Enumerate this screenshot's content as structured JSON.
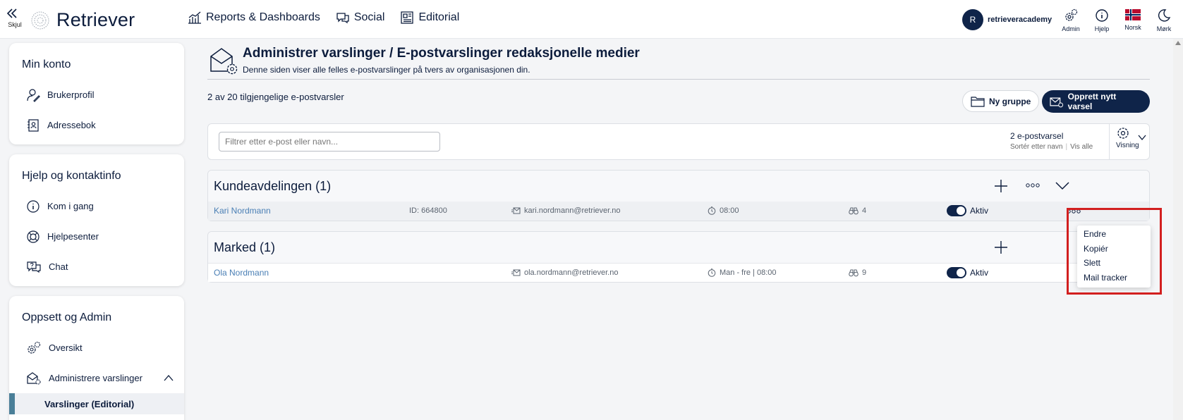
{
  "topbar": {
    "hide_label": "Skjul",
    "logo_text": "Retriever",
    "nav": [
      {
        "label": "Reports & Dashboards",
        "icon": "chart-icon"
      },
      {
        "label": "Social",
        "icon": "chat-bubbles-icon"
      },
      {
        "label": "Editorial",
        "icon": "newspaper-icon"
      }
    ],
    "user": {
      "initial": "R",
      "name": "retrieveracademy"
    },
    "icons": [
      {
        "label": "Admin",
        "icon": "admin-gear-icon"
      },
      {
        "label": "Hjelp",
        "icon": "info-icon"
      },
      {
        "label": "Norsk",
        "icon": "norway-flag-icon"
      },
      {
        "label": "Mørk",
        "icon": "moon-icon"
      }
    ]
  },
  "sidebar": {
    "account": {
      "title": "Min konto",
      "items": [
        {
          "label": "Brukerprofil",
          "icon": "user-edit-icon"
        },
        {
          "label": "Adressebok",
          "icon": "address-book-icon"
        }
      ]
    },
    "help": {
      "title": "Hjelp og kontaktinfo",
      "items": [
        {
          "label": "Kom i gang",
          "icon": "info-circle-icon"
        },
        {
          "label": "Hjelpesenter",
          "icon": "lifebuoy-icon"
        },
        {
          "label": "Chat",
          "icon": "chat-question-icon"
        }
      ]
    },
    "admin": {
      "title": "Oppsett og Admin",
      "items": [
        {
          "label": "Oversikt",
          "icon": "gears-icon"
        },
        {
          "label": "Administrere varslinger",
          "icon": "mail-settings-icon"
        }
      ],
      "active_sub": "Varslinger (Editorial)"
    }
  },
  "page": {
    "title": "Administrer varslinger / E-postvarslinger redaksjonelle medier",
    "subtitle": "Denne siden viser alle felles e-postvarslinger på tvers av organisasjonen din.",
    "count_text": "2 av 20 tilgjengelige e-postvarsler",
    "new_group_label": "Ny gruppe",
    "create_label": "Opprett nytt varsel"
  },
  "filter": {
    "placeholder": "Filtrer etter e-post eller navn...",
    "summary": "2 e-postvarsel",
    "sort_label": "Sortér etter navn",
    "show_all": "Vis alle",
    "view_label": "Visning"
  },
  "groups": [
    {
      "title": "Kundeavdelingen (1)",
      "rows": [
        {
          "name": "Kari Nordmann",
          "id": "ID: 664800",
          "email": "kari.nordmann@retriever.no",
          "schedule": "08:00",
          "sources": "4",
          "status": "Aktiv"
        }
      ]
    },
    {
      "title": "Marked (1)",
      "rows": [
        {
          "name": "Ola Nordmann",
          "id": "",
          "email": "ola.nordmann@retriever.no",
          "schedule": "Man - fre | 08:00",
          "sources": "9",
          "status": "Aktiv"
        }
      ]
    }
  ],
  "context_menu": [
    "Endre",
    "Kopiér",
    "Slett",
    "Mail tracker"
  ],
  "colors": {
    "brand_navy": "#0f2449",
    "link_blue": "#4a7fb5",
    "highlight_red": "#d21f1f",
    "active_bar": "#4a7f98"
  }
}
